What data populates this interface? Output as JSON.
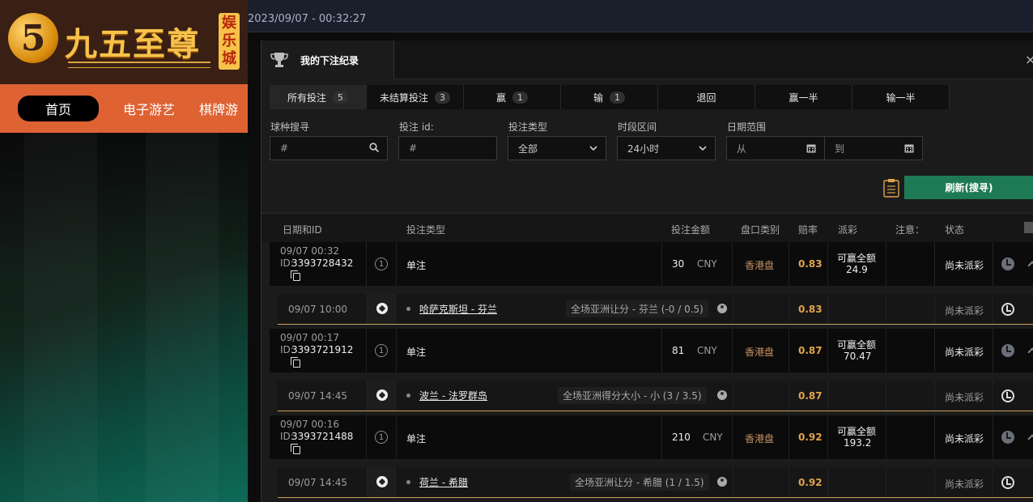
{
  "site": {
    "logo_number": "5",
    "logo_text": "九五至尊",
    "logo_side": "娱乐城",
    "nav": [
      "首页",
      "电子游艺",
      "棋牌游"
    ]
  },
  "topbar": {
    "datetime": "2023/09/07 - 00:32:27"
  },
  "modal": {
    "title": "我的下注纪录",
    "close": "×",
    "tabs": [
      {
        "label": "所有投注",
        "count": "5"
      },
      {
        "label": "未结算投注",
        "count": "3"
      },
      {
        "label": "赢",
        "count": "1"
      },
      {
        "label": "输",
        "count": "1"
      },
      {
        "label": "退回",
        "count": ""
      },
      {
        "label": "赢一半",
        "count": ""
      },
      {
        "label": "输一半",
        "count": ""
      }
    ],
    "filters": {
      "sport_label": "球种搜寻",
      "sport_placeholder": "#",
      "betid_label": "投注 id:",
      "betid_placeholder": "#",
      "type_label": "投注类型",
      "type_value": "全部",
      "period_label": "时段区间",
      "period_value": "24小时",
      "date_label": "日期范围",
      "date_from": "从",
      "date_to": "到"
    },
    "refresh_label": "刷新(搜寻)",
    "columns": {
      "date_id": "日期和ID",
      "bet_type": "投注类型",
      "amount": "投注金额",
      "odds_type": "盘口类别",
      "odds": "赔率",
      "payout": "派彩",
      "note": "注意：",
      "status": "状态"
    },
    "bets": [
      {
        "date": "09/07 00:32",
        "id_prefix": "ID:",
        "id": "3393728432",
        "legs": "1",
        "type": "单注",
        "amount": "30",
        "currency": "CNY",
        "odds_type": "香港盘",
        "odds": "0.83",
        "payout_label": "可赢全额",
        "payout": "24.9",
        "status": "尚未派彩",
        "sel": {
          "date": "09/07 10:00",
          "match": "哈萨克斯坦 - 芬兰",
          "market": "全场亚洲让分 - 芬兰 (-0 / 0.5)",
          "odds": "0.83",
          "status": "尚未派彩"
        }
      },
      {
        "date": "09/07 00:17",
        "id_prefix": "ID:",
        "id": "3393721912",
        "legs": "1",
        "type": "单注",
        "amount": "81",
        "currency": "CNY",
        "odds_type": "香港盘",
        "odds": "0.87",
        "payout_label": "可赢全额",
        "payout": "70.47",
        "status": "尚未派彩",
        "sel": {
          "date": "09/07 14:45",
          "match": "波兰 - 法罗群岛",
          "market": "全场亚洲得分大小 - 小 (3 / 3.5)",
          "odds": "0.87",
          "status": "尚未派彩"
        }
      },
      {
        "date": "09/07 00:16",
        "id_prefix": "ID:",
        "id": "3393721488",
        "legs": "1",
        "type": "单注",
        "amount": "210",
        "currency": "CNY",
        "odds_type": "香港盘",
        "odds": "0.92",
        "payout_label": "可赢全额",
        "payout": "193.2",
        "status": "尚未派彩",
        "sel": {
          "date": "09/07 14:45",
          "match": "荷兰 - 希腊",
          "market": "全场亚洲让分 - 希腊 (1 / 1.5)",
          "odds": "0.92",
          "status": "尚未派彩"
        }
      }
    ]
  },
  "colors": {
    "accent_green": "#1e7a55",
    "odds_gold": "#e1a34e",
    "nav_orange": "#df6233"
  }
}
